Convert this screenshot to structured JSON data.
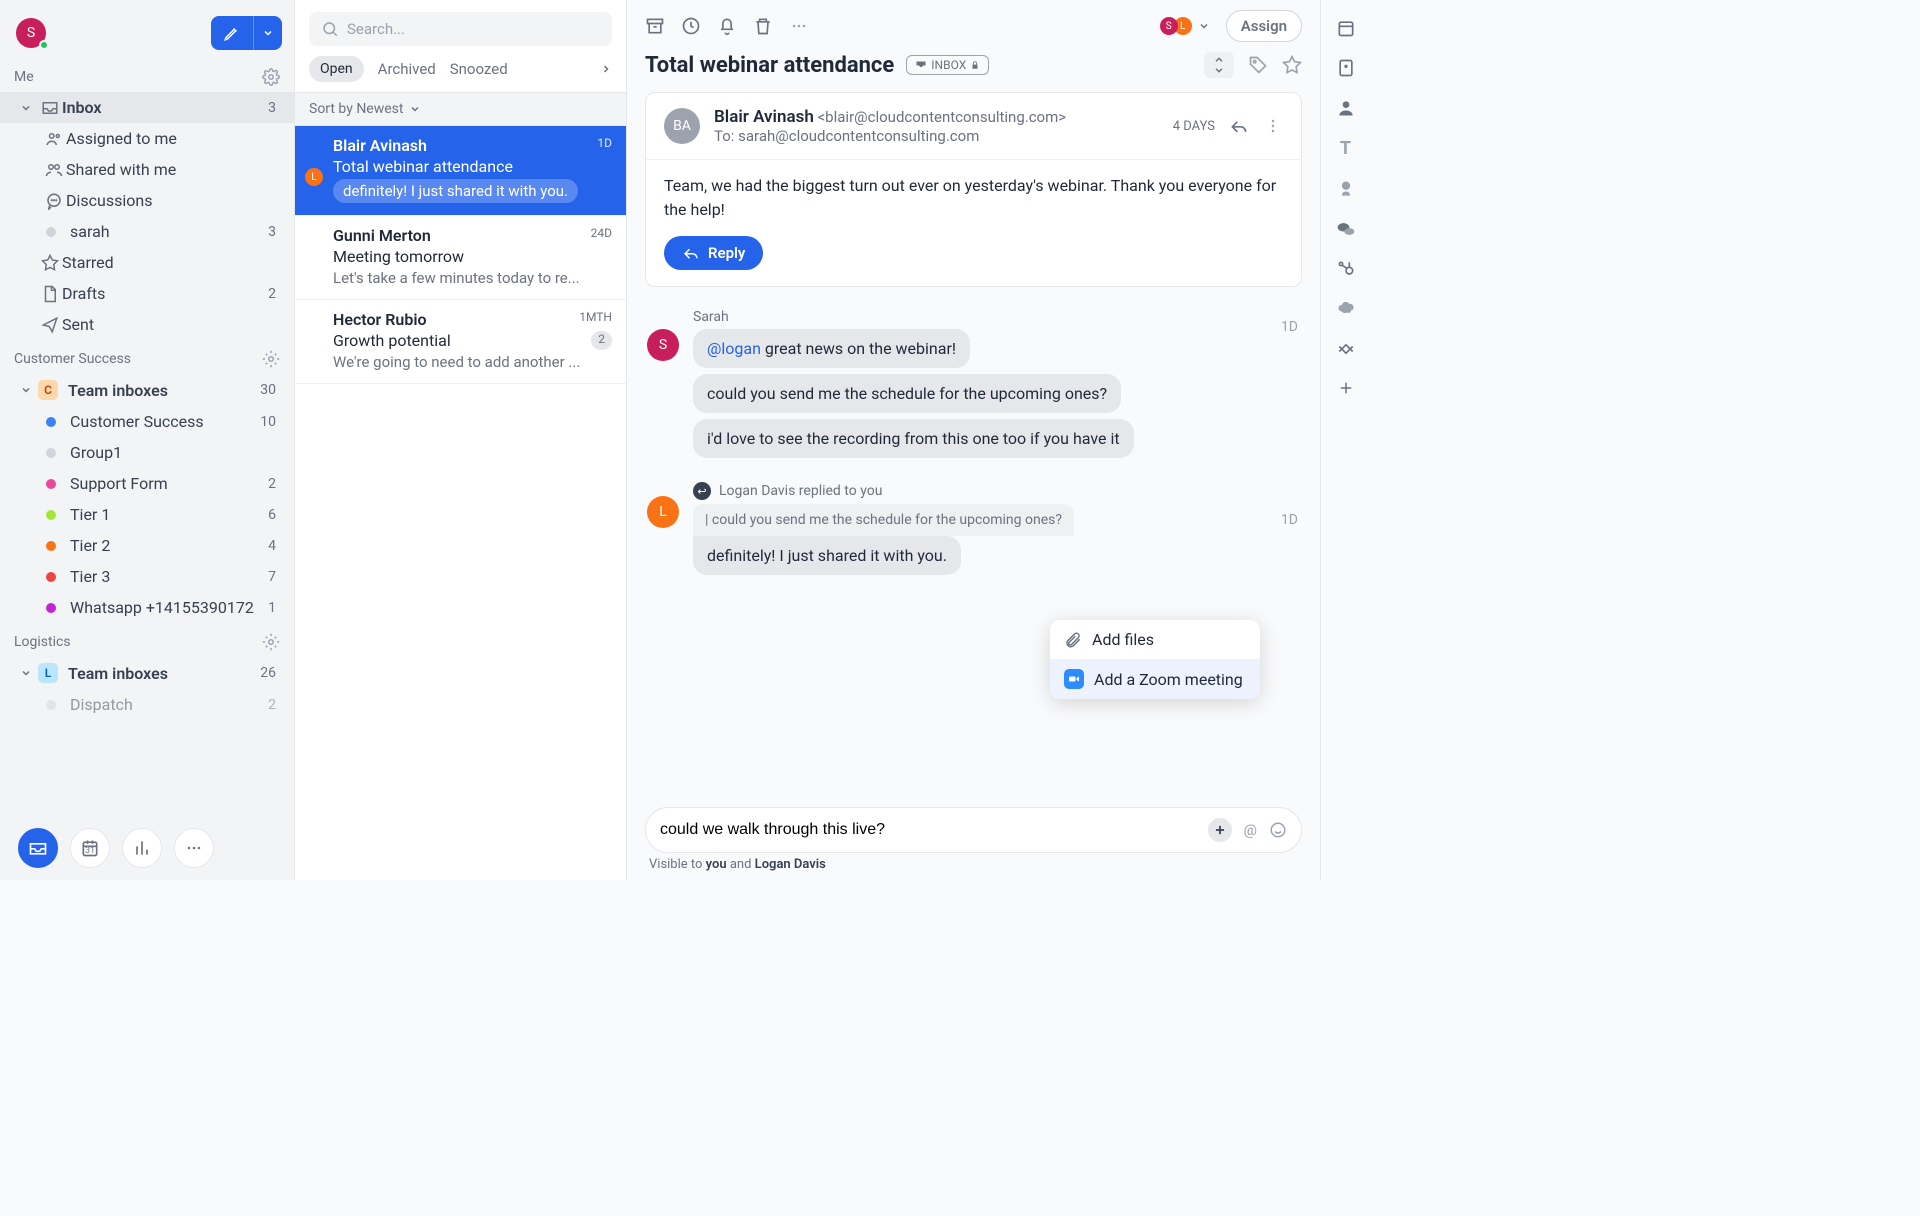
{
  "compose": {
    "label": "Compose"
  },
  "me_section": {
    "title": "Me",
    "inbox": {
      "label": "Inbox",
      "count": "3"
    },
    "assigned": {
      "label": "Assigned to me"
    },
    "shared": {
      "label": "Shared with me"
    },
    "discussions": {
      "label": "Discussions"
    },
    "sarah": {
      "label": "sarah",
      "count": "3"
    },
    "starred": {
      "label": "Starred"
    },
    "drafts": {
      "label": "Drafts",
      "count": "2"
    },
    "sent": {
      "label": "Sent"
    }
  },
  "cs_section": {
    "title": "Customer Success",
    "team": {
      "label": "Team inboxes",
      "count": "30"
    },
    "items": [
      {
        "label": "Customer Success",
        "count": "10",
        "color": "dot-blue"
      },
      {
        "label": "Group1",
        "count": "",
        "color": "dot-grey"
      },
      {
        "label": "Support Form",
        "count": "2",
        "color": "dot-pink"
      },
      {
        "label": "Tier 1",
        "count": "6",
        "color": "dot-lime"
      },
      {
        "label": "Tier 2",
        "count": "4",
        "color": "dot-orange"
      },
      {
        "label": "Tier 3",
        "count": "7",
        "color": "dot-red"
      },
      {
        "label": "Whatsapp +14155390172",
        "count": "1",
        "color": "dot-magenta"
      }
    ]
  },
  "log_section": {
    "title": "Logistics",
    "team": {
      "label": "Team inboxes",
      "count": "26"
    },
    "items": [
      {
        "label": "Dispatch",
        "count": "2",
        "color": "dot-grey"
      }
    ]
  },
  "search": {
    "placeholder": "Search..."
  },
  "tabs": {
    "open": "Open",
    "archived": "Archived",
    "snoozed": "Snoozed"
  },
  "sort": {
    "label": "Sort by Newest"
  },
  "conversations": [
    {
      "sender": "Blair Avinash",
      "time": "1D",
      "subject": "Total webinar attendance",
      "preview": "definitely! I just shared it with you.",
      "avatar": "L"
    },
    {
      "sender": "Gunni Merton",
      "time": "24D",
      "subject": "Meeting tomorrow",
      "preview": "Let's take a few minutes today to re..."
    },
    {
      "sender": "Hector Rubio",
      "time": "1MTH",
      "subject": "Growth potential",
      "preview": "We're going to need to add another ...",
      "badge": "2"
    }
  ],
  "detail": {
    "assign": "Assign",
    "title": "Total webinar attendance",
    "inbox_badge": "INBOX",
    "from_name": "Blair Avinash",
    "from_email": "<blair@cloudcontentconsulting.com>",
    "to": "To: sarah@cloudcontentconsulting.com",
    "from_initials": "BA",
    "age": "4 DAYS",
    "body": "Team, we had the biggest turn out ever on yesterday's webinar. Thank you everyone for the help!",
    "reply": "Reply"
  },
  "comments": {
    "sarah": {
      "name": "Sarah",
      "initial": "S",
      "msg1_mention": "@logan",
      "msg1_text": " great news on the webinar!",
      "msg2": "could you send me the schedule for the upcoming ones?",
      "msg3": "i'd love to see the recording from this one too if you have it",
      "time": "1D"
    },
    "logan": {
      "replied": "Logan Davis replied to you",
      "initial": "L",
      "quote": "could you send me the schedule for the upcoming ones?",
      "msg": "definitely! I just shared it with you.",
      "time": "1D"
    }
  },
  "popup": {
    "add_files": "Add files",
    "add_zoom": "Add a Zoom meeting"
  },
  "composer": {
    "value": "could we walk through this live?",
    "visible_prefix": "Visible to ",
    "visible_you": "you",
    "visible_and": " and ",
    "visible_logan": "Logan Davis"
  }
}
